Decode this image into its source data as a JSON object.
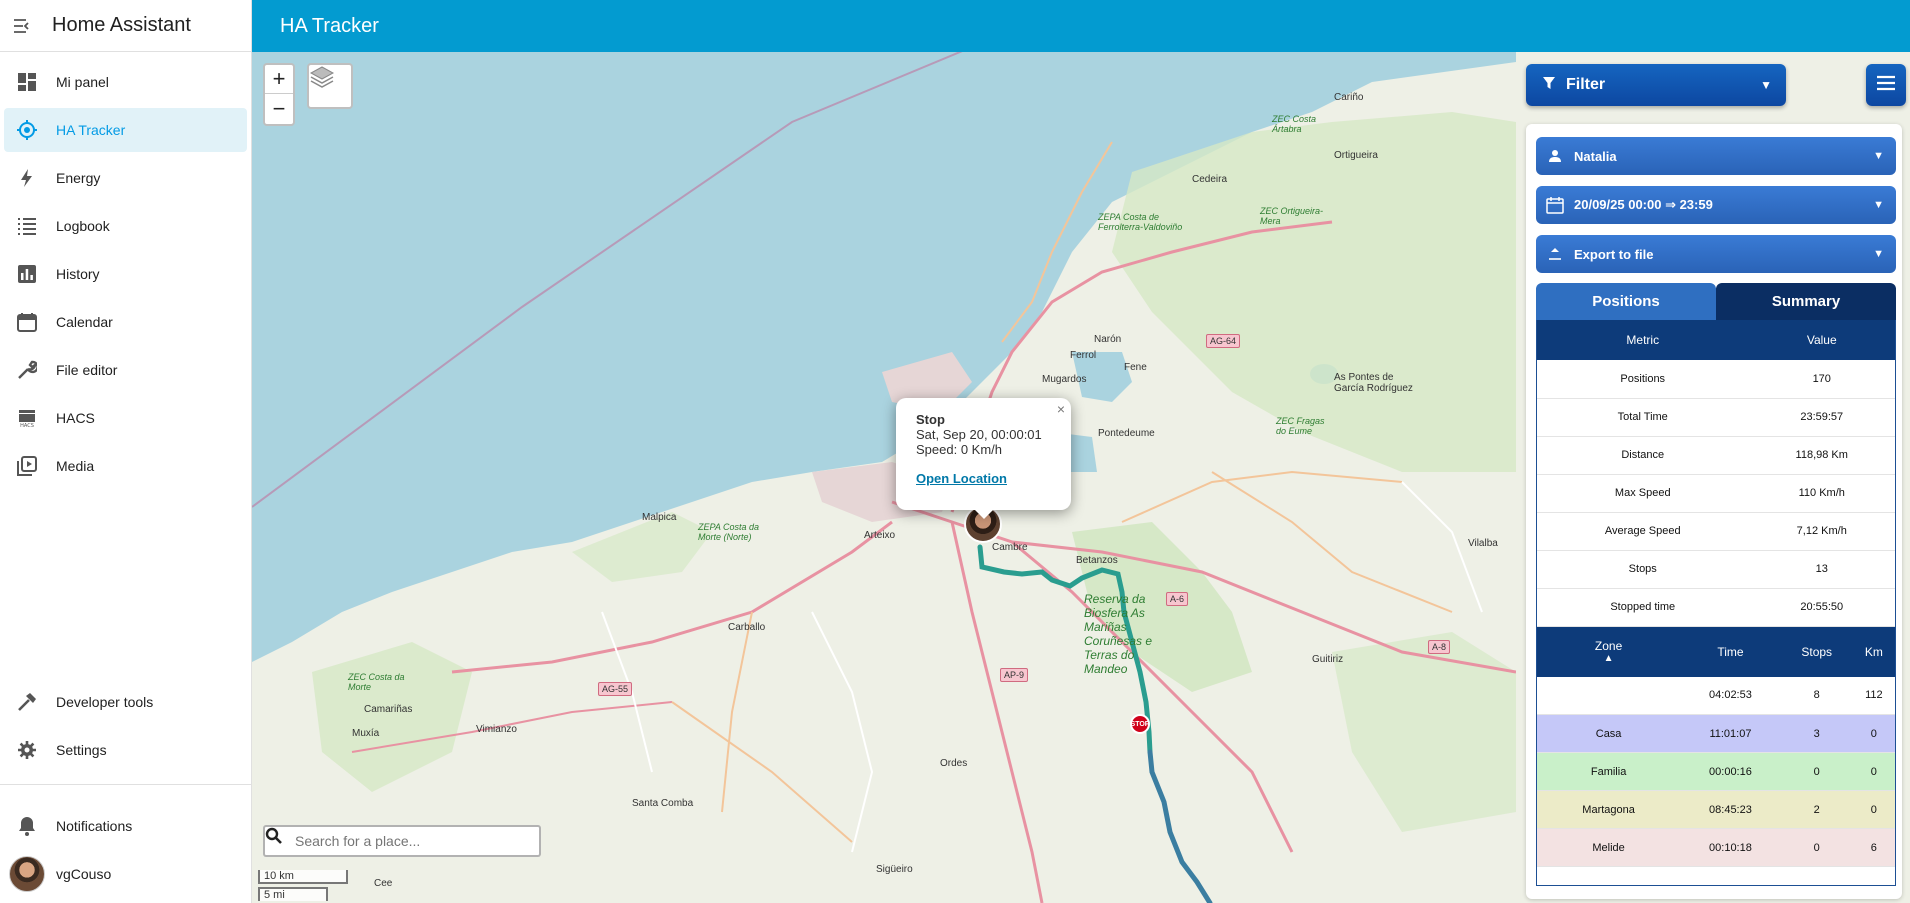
{
  "app": {
    "title": "Home Assistant"
  },
  "sidebar": {
    "items": [
      {
        "label": "Mi panel",
        "icon": "dashboard-icon"
      },
      {
        "label": "HA Tracker",
        "icon": "target-icon"
      },
      {
        "label": "Energy",
        "icon": "lightning-icon"
      },
      {
        "label": "Logbook",
        "icon": "list-icon"
      },
      {
        "label": "History",
        "icon": "bar-chart-icon"
      },
      {
        "label": "Calendar",
        "icon": "calendar-icon"
      },
      {
        "label": "File editor",
        "icon": "wrench-icon"
      },
      {
        "label": "HACS",
        "icon": "hacs-icon"
      },
      {
        "label": "Media",
        "icon": "play-library-icon"
      }
    ],
    "bottom_items": [
      {
        "label": "Developer tools",
        "icon": "hammer-icon"
      },
      {
        "label": "Settings",
        "icon": "gear-icon"
      }
    ],
    "notifications_label": "Notifications",
    "user_name": "vgCouso"
  },
  "topbar": {
    "title": "HA Tracker"
  },
  "map": {
    "zoom_in": "+",
    "zoom_out": "−",
    "search_placeholder": "Search for a place...",
    "scale_km": "10 km",
    "scale_mi": "5 mi",
    "popup": {
      "title": "Stop",
      "date": "Sat, Sep 20, 00:00:01",
      "speed": "Speed: 0 Km/h",
      "link": "Open Location",
      "close": "×"
    },
    "stop_marker_label": "STOP",
    "places": [
      "Cariño",
      "Ortigueira",
      "Cedeira",
      "Narón",
      "Ferrol",
      "Fene",
      "Mugardos",
      "Pontedeume",
      "As Pontes de García Rodríguez",
      "Malpica",
      "Arteixo",
      "Betanzos",
      "Carballo",
      "Camariñas",
      "Muxía",
      "Vimianzo",
      "Ordes",
      "Santa Comba",
      "Sigüeiro",
      "Guitiriz",
      "Vilalba",
      "Cee",
      "Cambre"
    ],
    "protected_areas": [
      "ZEC Costa Ártabra",
      "ZEPA Costa de Ferrolterra-Valdoviño",
      "ZEC Ortigueira-Mera",
      "ZEC Fragas do Eume",
      "ZEPA Costa da Morte (Norte)",
      "ZEC Costa da Morte",
      "Reserva da Biosfera As Mariñas Coruñesas e Terras do Mandeo"
    ],
    "roads": [
      "AG-64",
      "A-6",
      "AP-9",
      "AG-55",
      "A-8"
    ]
  },
  "panel": {
    "filter_label": "Filter",
    "person_label": "Natalia",
    "date_range_label": "20/09/25 00:00 ⇒ 23:59",
    "export_label": "Export to file",
    "tabs": [
      "Positions",
      "Summary"
    ],
    "summary": {
      "headers": [
        "Metric",
        "Value"
      ],
      "rows": [
        [
          "Positions",
          "170"
        ],
        [
          "Total Time",
          "23:59:57"
        ],
        [
          "Distance",
          "118,98 Km"
        ],
        [
          "Max Speed",
          "110 Km/h"
        ],
        [
          "Average Speed",
          "7,12 Km/h"
        ],
        [
          "Stops",
          "13"
        ],
        [
          "Stopped time",
          "20:55:50"
        ]
      ]
    },
    "zones": {
      "headers": [
        "Zone",
        "Time",
        "Stops",
        "Km"
      ],
      "sort_indicator": "▲",
      "rows": [
        {
          "zone": "",
          "time": "04:02:53",
          "stops": "8",
          "km": "112",
          "color": "#ffffff"
        },
        {
          "zone": "Casa",
          "time": "11:01:07",
          "stops": "3",
          "km": "0",
          "color": "#c5c8f8"
        },
        {
          "zone": "Familia",
          "time": "00:00:16",
          "stops": "0",
          "km": "0",
          "color": "#c9f0c9"
        },
        {
          "zone": "Martagona",
          "time": "08:45:23",
          "stops": "2",
          "km": "0",
          "color": "#ecebc8"
        },
        {
          "zone": "Melide",
          "time": "00:10:18",
          "stops": "0",
          "km": "6",
          "color": "#f3e2e2"
        }
      ]
    }
  },
  "colors": {
    "topbar": "#039bd0",
    "active_nav": "#039be5",
    "sea": "#aad3df",
    "route": "#2a9d8f",
    "route_tail": "#3b7ea1",
    "stop_marker": "#d0021b",
    "panel_dark": "#0d3b7a"
  }
}
